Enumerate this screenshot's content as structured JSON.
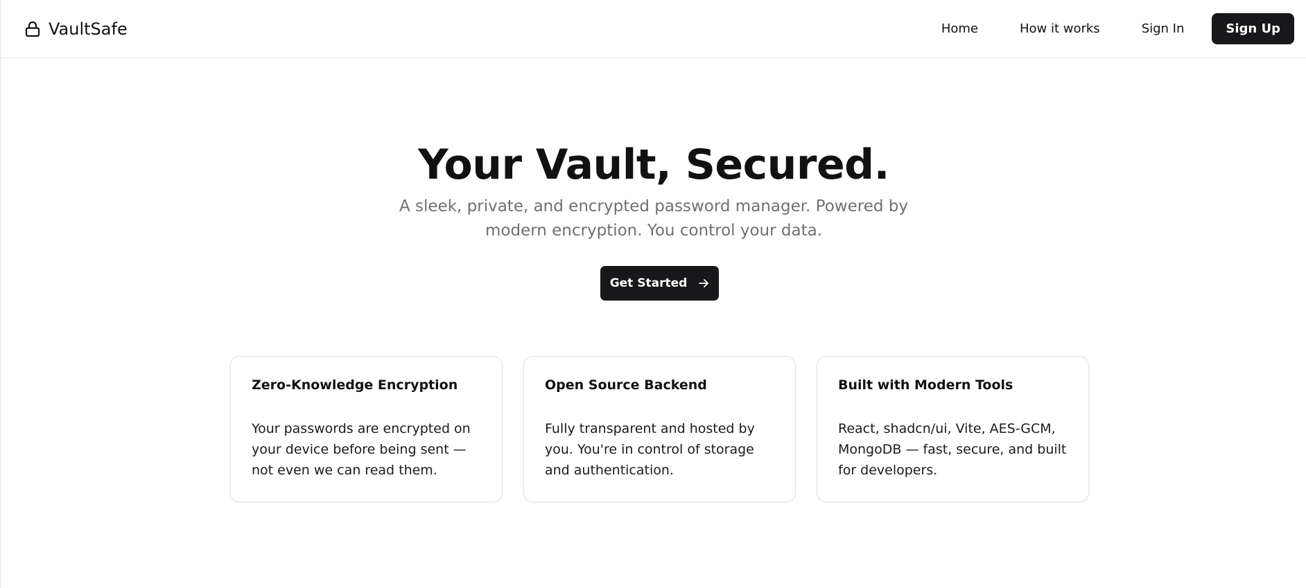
{
  "header": {
    "brand_name": "VaultSafe",
    "brand_icon": "lock-icon",
    "nav": {
      "home": "Home",
      "how_it_works": "How it works",
      "sign_in": "Sign In",
      "sign_up": "Sign Up"
    }
  },
  "hero": {
    "title": "Your Vault, Secured.",
    "subtitle": "A sleek, private, and encrypted password manager. Powered by modern encryption. You control your data.",
    "cta_label": "Get Started",
    "cta_icon": "arrow-right-icon"
  },
  "features": [
    {
      "title": "Zero-Knowledge Encryption",
      "body": "Your passwords are encrypted on your device before being sent — not even we can read them."
    },
    {
      "title": "Open Source Backend",
      "body": "Fully transparent and hosted by you. You're in control of storage and authentication."
    },
    {
      "title": "Built with Modern Tools",
      "body": "React, shadcn/ui, Vite, AES-GCM, MongoDB — fast, secure, and built for developers."
    }
  ],
  "colors": {
    "primary_button": "#18181b",
    "text": "#111111",
    "muted_text": "#707070",
    "card_border": "#e4e4e7"
  }
}
